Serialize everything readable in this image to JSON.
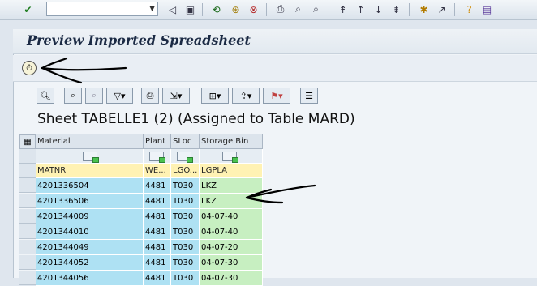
{
  "window": {
    "title": "Preview Imported Spreadsheet"
  },
  "toolbar": {
    "command_field_value": "",
    "icons": [
      "checkmark-icon",
      "back-triangle-icon",
      "save-icon",
      "back-icon",
      "exit-icon",
      "cancel-icon",
      "print-icon",
      "find-icon",
      "find-next-icon",
      "first-page-icon",
      "previous-page-icon",
      "next-page-icon",
      "last-page-icon",
      "create-session-icon",
      "shortcut-icon",
      "help-icon",
      "customize-layout-icon"
    ]
  },
  "execute": {
    "icon": "clock-execute-icon"
  },
  "grid_toolbar": {
    "buttons": [
      "details-icon",
      "find-icon",
      "find-next-icon",
      "filter-icon",
      "print-icon",
      "export-icon",
      "layout-icon",
      "upload-icon",
      "flag-icon",
      "list-icon"
    ]
  },
  "sheet": {
    "title": "Sheet TABELLE1 (2) (Assigned to Table MARD)"
  },
  "table": {
    "columns": [
      "Material",
      "Plant",
      "SLoc",
      "Storage Bin"
    ],
    "technical_names": [
      "MATNR",
      "WE...",
      "LGO...",
      "LGPLA"
    ],
    "rows": [
      [
        "4201336504",
        "4481",
        "T030",
        "LKZ"
      ],
      [
        "4201336506",
        "4481",
        "T030",
        "LKZ"
      ],
      [
        "4201344009",
        "4481",
        "T030",
        "04-07-40"
      ],
      [
        "4201344010",
        "4481",
        "T030",
        "04-07-40"
      ],
      [
        "4201344049",
        "4481",
        "T030",
        "04-07-20"
      ],
      [
        "4201344052",
        "4481",
        "T030",
        "04-07-30"
      ],
      [
        "4201344056",
        "4481",
        "T030",
        "04-07-30"
      ]
    ]
  },
  "colors": {
    "source_column": "#aee1f3",
    "target_column": "#c7efc1",
    "technical_row": "#fff2b3"
  }
}
